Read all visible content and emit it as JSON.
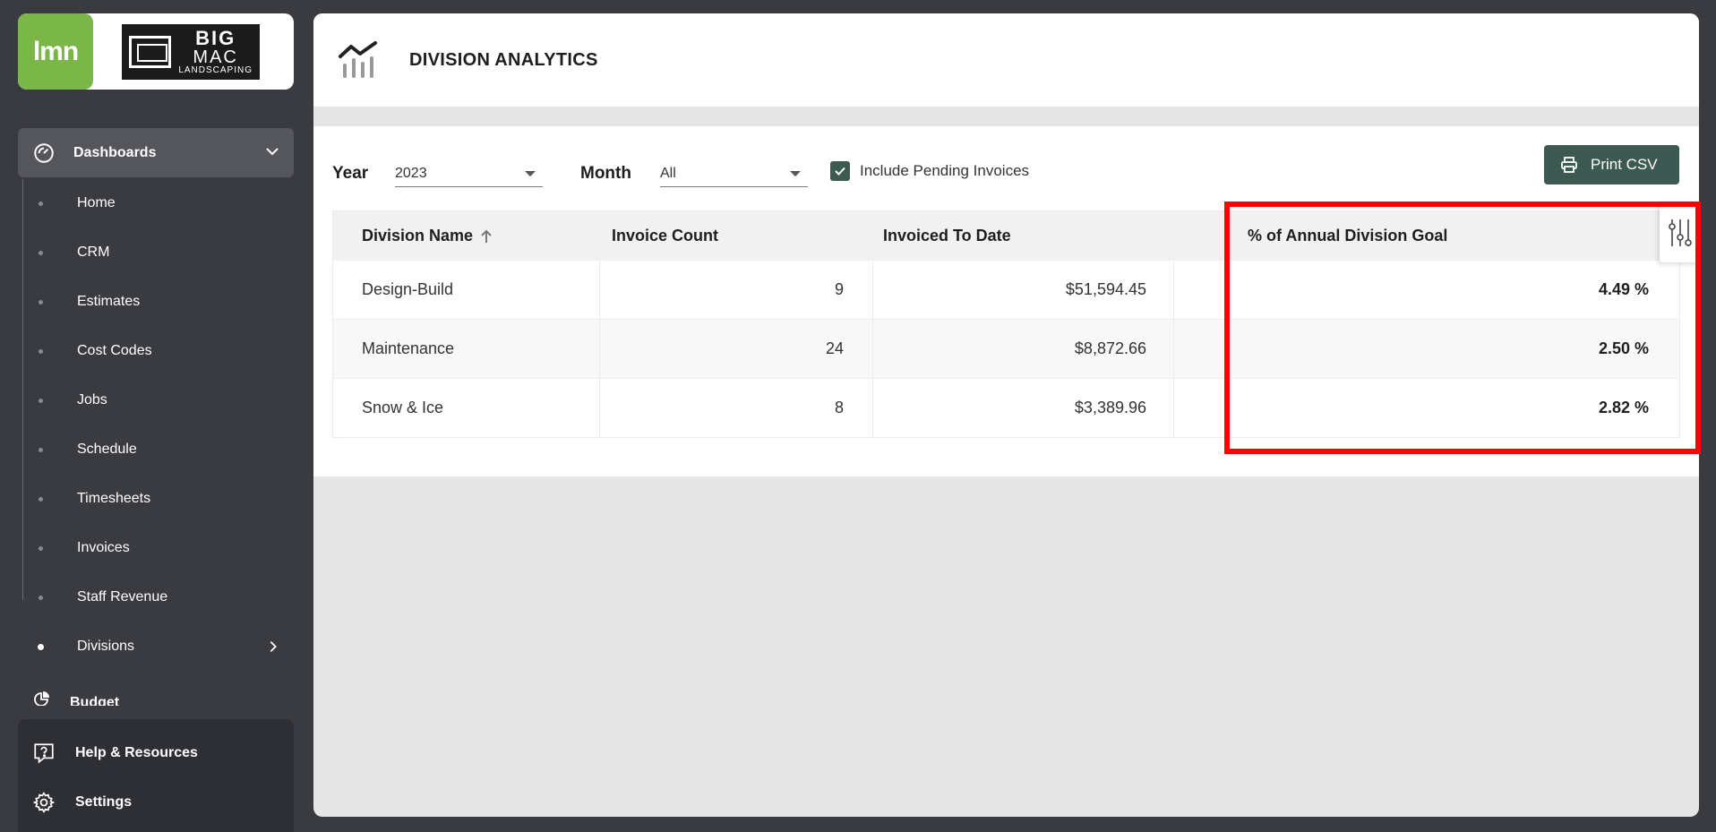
{
  "brand": {
    "lmn_logo": "lmn",
    "partner_logo": {
      "line1": "BIG",
      "line2": "MAC",
      "line3": "LANDSCAPING"
    }
  },
  "sidebar": {
    "dashboards_label": "Dashboards",
    "items": [
      {
        "label": "Home"
      },
      {
        "label": "CRM"
      },
      {
        "label": "Estimates"
      },
      {
        "label": "Cost Codes"
      },
      {
        "label": "Jobs"
      },
      {
        "label": "Schedule"
      },
      {
        "label": "Timesheets"
      },
      {
        "label": "Invoices"
      },
      {
        "label": "Staff Revenue"
      },
      {
        "label": "Divisions",
        "active": true
      }
    ],
    "budget_label": "Budget",
    "help_label": "Help & Resources",
    "settings_label": "Settings"
  },
  "header": {
    "title": "DIVISION ANALYTICS"
  },
  "filters": {
    "year_label": "Year",
    "year_value": "2023",
    "month_label": "Month",
    "month_value": "All",
    "include_pending_label": "Include Pending Invoices",
    "include_pending_checked": true,
    "print_label": "Print CSV"
  },
  "table": {
    "columns": [
      "Division Name",
      "Invoice Count",
      "Invoiced To Date",
      "% of Annual Division Goal"
    ],
    "sort_column": "Division Name",
    "sort_direction": "ascending",
    "rows": [
      {
        "division": "Design-Build",
        "count": "9",
        "invoiced": "$51,594.45",
        "goal": "4.49 %"
      },
      {
        "division": "Maintenance",
        "count": "24",
        "invoiced": "$8,872.66",
        "goal": "2.50 %"
      },
      {
        "division": "Snow & Ice",
        "count": "8",
        "invoiced": "$3,389.96",
        "goal": "2.82 %"
      }
    ]
  },
  "colors": {
    "accent": "#3d5a52",
    "sidebar_bg": "#3a3b41",
    "lmn_green": "#7ab648",
    "highlight": "#ff0000"
  }
}
